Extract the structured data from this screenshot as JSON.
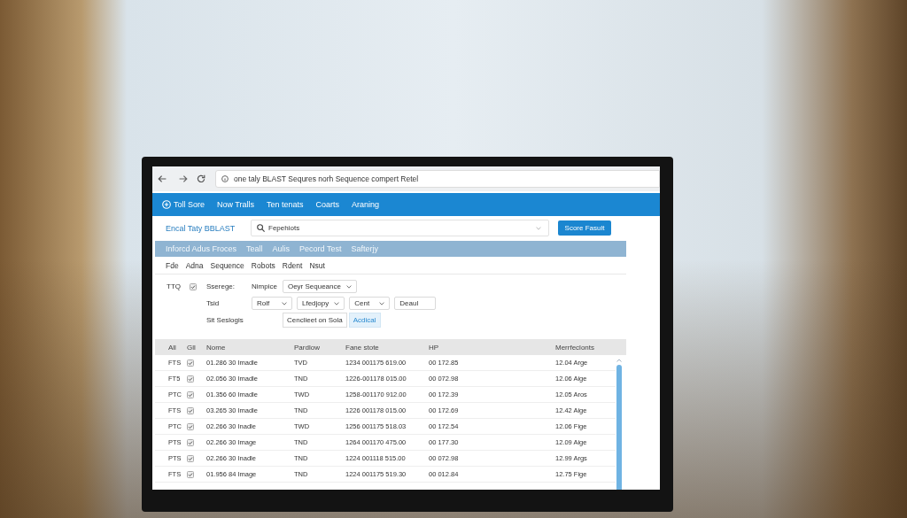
{
  "browser": {
    "address": "one taly BLAST Sequres norh Sequence compert Retel"
  },
  "nav": {
    "items": [
      "Toll Sore",
      "Now Tralls",
      "Ten tenats",
      "Coarts",
      "Araning"
    ]
  },
  "header": {
    "title": "Encal Taty BBLAST",
    "search": {
      "value": "Fepehiots"
    },
    "button": "Score Fasult"
  },
  "tabs": [
    {
      "label": "Inforcd Adus Froces",
      "selected": false
    },
    {
      "label": "Teall",
      "selected": false
    },
    {
      "label": "Aulis",
      "selected": false
    },
    {
      "label": "Pecord Test",
      "selected": false
    },
    {
      "label": "Safterjy",
      "selected": false
    }
  ],
  "menu": [
    "Fde",
    "Adna",
    "Sequence",
    "Robots",
    "Rdent",
    "Nsut"
  ],
  "form": {
    "tag": {
      "label": "TTQ",
      "checked": true
    },
    "rows": [
      {
        "label": "Sserege:",
        "controls": [
          {
            "kind": "text",
            "text": "Nimpice"
          },
          {
            "kind": "select",
            "value": "Oeyr Sequeance"
          }
        ]
      },
      {
        "label": "Tsid",
        "controls": [
          {
            "kind": "select",
            "value": "Rolf"
          },
          {
            "kind": "select",
            "value": "Lfedjopy"
          },
          {
            "kind": "select",
            "value": "Cent"
          },
          {
            "kind": "input",
            "value": "Deaul"
          }
        ]
      },
      {
        "label": "Sit Seslogis",
        "controls": [
          {
            "kind": "segmented",
            "options": [
              {
                "label": "Cenclieet on Sola",
                "selected": false
              },
              {
                "label": "Acdical",
                "selected": true
              }
            ]
          }
        ]
      }
    ]
  },
  "table": {
    "columns": [
      "All",
      "Gll",
      "Nome",
      "Pardlow",
      "Fane stote",
      "HP",
      "Merrfeclonts"
    ],
    "rows": [
      {
        "cells": [
          "FTS",
          {
            "checked": true
          },
          "01.286 30 Imadle",
          "TVD",
          "1234 001175 619.00",
          "00 172.85",
          "12.04 Arge"
        ]
      },
      {
        "cells": [
          "FT5",
          {
            "checked": true
          },
          "02.056 30 Imadle",
          "TND",
          "1226-001178 015.00",
          "00 072.98",
          "12.06 Aige"
        ]
      },
      {
        "cells": [
          "PTC",
          {
            "checked": true
          },
          "01.356 60 Imadle",
          "TWD",
          "1258-001170 912.00",
          "00 172.39",
          "12.05 Aros"
        ]
      },
      {
        "cells": [
          "FTS",
          {
            "checked": true
          },
          "03.265 30 Imadle",
          "TND",
          "1226 001178 015.00",
          "00 172.69",
          "12.42 Aige"
        ]
      },
      {
        "cells": [
          "PTC",
          {
            "checked": true
          },
          "02.266 30 Inadle",
          "TWD",
          "1256 001175 518.03",
          "00 172.54",
          "12.06 Fige"
        ]
      },
      {
        "cells": [
          "PTS",
          {
            "checked": true
          },
          "02.266 30 Image",
          "TND",
          "1264 001170 475.00",
          "00 177.30",
          "12.09 Aige"
        ]
      },
      {
        "cells": [
          "PTS",
          {
            "checked": true
          },
          "02.266 30 Inadle",
          "TND",
          "1224 001118 515.00",
          "00 072.98",
          "12.99 Args"
        ]
      },
      {
        "cells": [
          "FTS",
          {
            "checked": true
          },
          "01.956 84 Image",
          "TND",
          "1224 001175 519.30",
          "00 012.84",
          "12.75 Fige"
        ]
      }
    ]
  }
}
